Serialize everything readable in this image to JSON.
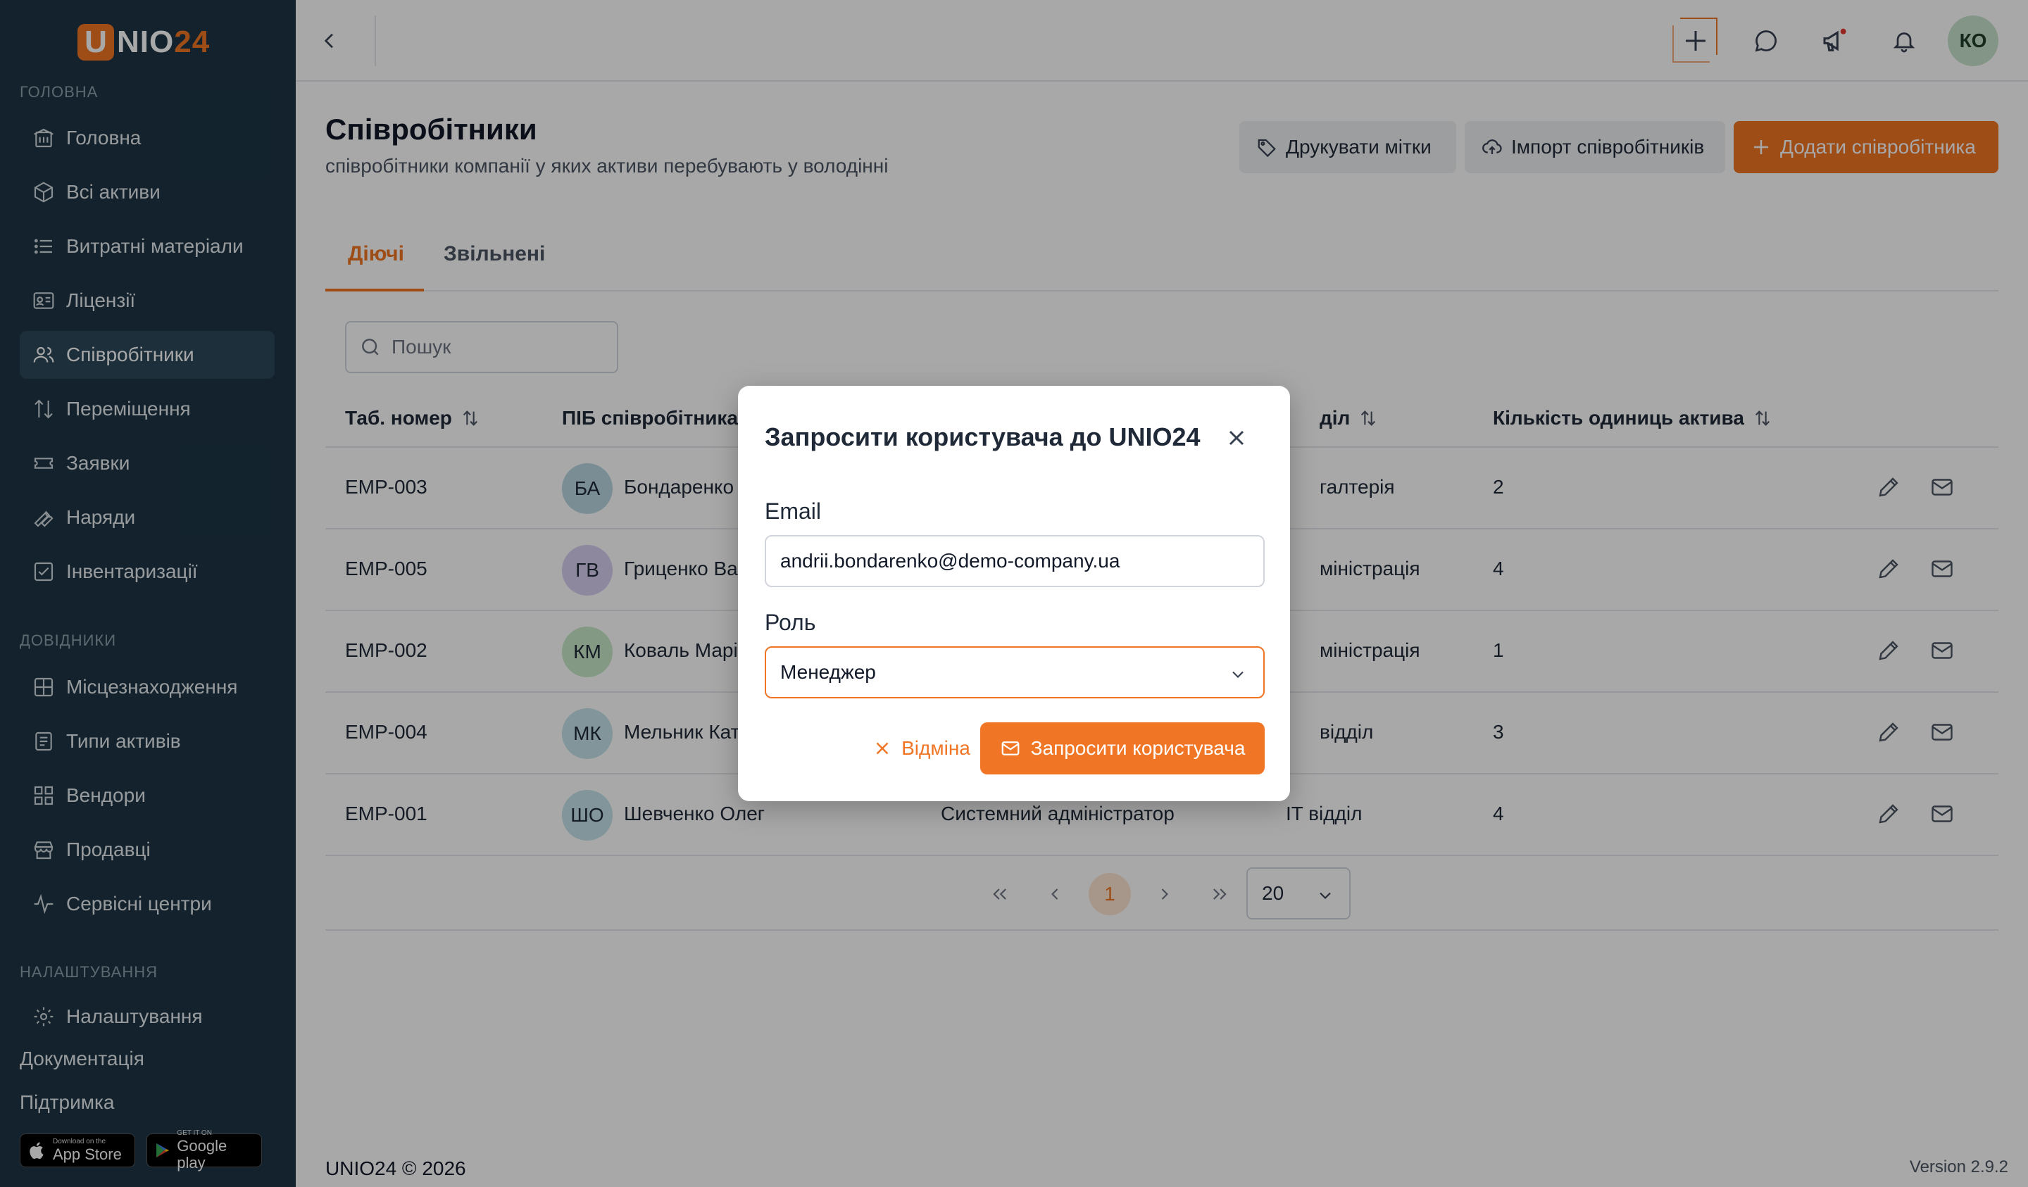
{
  "brand": {
    "letter": "U",
    "name_white": "NIO",
    "name_orange": "24"
  },
  "sidebar": {
    "sections": [
      {
        "label": "ГОЛОВНА"
      },
      {
        "label": "ДОВІДНИКИ"
      },
      {
        "label": "НАЛАШТУВАННЯ"
      }
    ],
    "items": [
      {
        "label": "Головна",
        "icon": "building-icon"
      },
      {
        "label": "Всі активи",
        "icon": "box-icon"
      },
      {
        "label": "Витратні матеріали",
        "icon": "list-icon"
      },
      {
        "label": "Ліцензії",
        "icon": "id-card-icon"
      },
      {
        "label": "Співробітники",
        "icon": "users-icon",
        "active": true
      },
      {
        "label": "Переміщення",
        "icon": "arrows-updown-icon"
      },
      {
        "label": "Заявки",
        "icon": "ticket-icon"
      },
      {
        "label": "Наряди",
        "icon": "wrench-icon"
      },
      {
        "label": "Інвентаризації",
        "icon": "checkbox-icon"
      },
      {
        "label": "Місцезнаходження",
        "icon": "grid-icon"
      },
      {
        "label": "Типи активів",
        "icon": "document-icon"
      },
      {
        "label": "Вендори",
        "icon": "vendor-icon"
      },
      {
        "label": "Продавці",
        "icon": "store-icon"
      },
      {
        "label": "Сервісні центри",
        "icon": "pulse-icon"
      },
      {
        "label": "Налаштування",
        "icon": "gear-icon"
      }
    ],
    "links": {
      "docs": "Документація",
      "support": "Підтримка"
    },
    "stores": {
      "appstore_small": "Download on the",
      "appstore_big": "App Store",
      "googleplay_small": "GET IT ON",
      "googleplay_big": "Google play"
    }
  },
  "topbar": {
    "user_initials": "КО"
  },
  "page": {
    "title": "Співробітники",
    "subtitle": "співробітники компанії у яких активи перебувають у володінні",
    "buttons": {
      "print": "Друкувати мітки",
      "import": "Імпорт співробітників",
      "add": "Додати співробітника"
    },
    "tabs": {
      "active": "Діючі",
      "fired": "Звільнені"
    },
    "search_placeholder": "Пошук"
  },
  "table": {
    "headers": {
      "tab_number": "Таб. номер",
      "name": "ПІБ співробітника",
      "department": "діл",
      "assets": "Кількість одиниць актива"
    },
    "rows": [
      {
        "tab": "EMP-003",
        "initials": "БА",
        "avatar_color": "#b9d6e2",
        "name": "Бондаренко",
        "position": "",
        "department": "галтерія",
        "assets": "2"
      },
      {
        "tab": "EMP-005",
        "initials": "ГВ",
        "avatar_color": "#d6cff0",
        "name": "Гриценко Ва",
        "position": "",
        "department": "міністрація",
        "assets": "4"
      },
      {
        "tab": "EMP-002",
        "initials": "КМ",
        "avatar_color": "#c9e8c7",
        "name": "Коваль Марі",
        "position": "",
        "department": "міністрація",
        "assets": "1"
      },
      {
        "tab": "EMP-004",
        "initials": "МК",
        "avatar_color": "#c4e3ea",
        "name": "Мельник Кат",
        "position": "",
        "department": "відділ",
        "assets": "3"
      },
      {
        "tab": "EMP-001",
        "initials": "ШО",
        "avatar_color": "#c4e3ea",
        "name": "Шевченко Олег",
        "position": "Системний адміністратор",
        "department": "IT відділ",
        "assets": "4"
      }
    ]
  },
  "pagination": {
    "current_page": "1",
    "page_size": "20"
  },
  "footer": {
    "copyright": "UNIO24 © 2026",
    "version": "Version 2.9.2"
  },
  "modal": {
    "title": "Запросити користувача до UNIO24",
    "email_label": "Email",
    "email_value": "andrii.bondarenko@demo-company.ua",
    "role_label": "Роль",
    "role_value": "Менеджер",
    "cancel": "Відміна",
    "invite": "Запросити користувача"
  },
  "colors": {
    "accent": "#f07524",
    "sidebar_bg": "#1d3544"
  }
}
